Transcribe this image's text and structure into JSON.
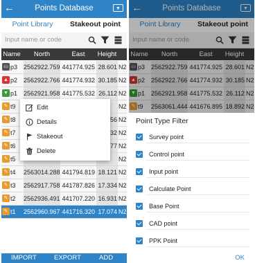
{
  "header": {
    "back_icon": "←",
    "title": "Points Database",
    "menu_icon": "▼"
  },
  "tabs": [
    {
      "label": "Point Library",
      "active": true
    },
    {
      "label": "Stakeout point",
      "active": false
    }
  ],
  "search": {
    "placeholder": "Input name or code"
  },
  "columns": {
    "name": "Name",
    "north": "North",
    "east": "East",
    "height": "Height"
  },
  "colors": {
    "accent": "#2f84c7",
    "badge_orange": "#e89a2e",
    "badge_red": "#d9342b",
    "badge_green": "#3c9a3c",
    "badge_gray": "#555555"
  },
  "rows_left": [
    {
      "badge": "gray",
      "code": "p3",
      "north": "2562922.759",
      "east": "441774.925",
      "height": "28.601",
      "n2": "N2"
    },
    {
      "badge": "red",
      "code": "p2",
      "north": "2562922.766",
      "east": "441774.932",
      "height": "30.185",
      "n2": "N2"
    },
    {
      "badge": "green",
      "code": "p1",
      "north": "2562921.958",
      "east": "441775.532",
      "height": "26.112",
      "n2": "N2"
    },
    {
      "badge": "orange",
      "code": "t9",
      "north": "",
      "east": "",
      "height": "",
      "n2": "N2"
    },
    {
      "badge": "orange",
      "code": "t8",
      "north": "",
      "east": "",
      "height": "56",
      "n2": "N2"
    },
    {
      "badge": "orange",
      "code": "t7",
      "north": "",
      "east": "",
      "height": "32",
      "n2": "N2"
    },
    {
      "badge": "orange",
      "code": "t6",
      "north": "",
      "east": "",
      "height": "77",
      "n2": "N2"
    },
    {
      "badge": "orange",
      "code": "t5",
      "north": "",
      "east": "",
      "height": "",
      "n2": "N2"
    },
    {
      "badge": "orange",
      "code": "t4",
      "north": "2563014.288",
      "east": "441794.819",
      "height": "18.121",
      "n2": "N2"
    },
    {
      "badge": "orange",
      "code": "t3",
      "north": "2562917.758",
      "east": "441787.826",
      "height": "17.334",
      "n2": "N2"
    },
    {
      "badge": "orange",
      "code": "t2",
      "north": "2562936.491",
      "east": "441707.220",
      "height": "16.931",
      "n2": "N2"
    },
    {
      "badge": "orange",
      "code": "t1",
      "north": "2562960.967",
      "east": "441716.320",
      "height": "17.074",
      "n2": "N2",
      "selected": true
    }
  ],
  "rows_right": [
    {
      "badge": "gray",
      "code": "p3",
      "north": "2562922.759",
      "east": "441774.925",
      "height": "28.601",
      "n2": "N2"
    },
    {
      "badge": "red",
      "code": "p2",
      "north": "2562922.766",
      "east": "441774.932",
      "height": "30.185",
      "n2": "N2"
    },
    {
      "badge": "green",
      "code": "p1",
      "north": "2562921.958",
      "east": "441775.532",
      "height": "26.112",
      "n2": "N2"
    },
    {
      "badge": "orange",
      "code": "t9",
      "north": "2563061.444",
      "east": "441676.895",
      "height": "18.892",
      "n2": "N2"
    }
  ],
  "context_menu": [
    {
      "label": "Edit",
      "icon": "edit-icon"
    },
    {
      "label": "Details",
      "icon": "info-icon"
    },
    {
      "label": "Stakeout",
      "icon": "flag-icon"
    },
    {
      "label": "Delete",
      "icon": "trash-icon"
    }
  ],
  "footer": {
    "import": "IMPORT",
    "export": "EXPORT",
    "add": "ADD"
  },
  "filter": {
    "title": "Point Type Filter",
    "items": [
      {
        "label": "Survey point",
        "checked": true
      },
      {
        "label": "Control point",
        "checked": true
      },
      {
        "label": "Input point",
        "checked": true
      },
      {
        "label": "Calculate Point",
        "checked": true
      },
      {
        "label": "Base Point",
        "checked": true
      },
      {
        "label": "CAD point",
        "checked": true
      },
      {
        "label": "PPK Point",
        "checked": true
      }
    ],
    "ok": "OK"
  }
}
